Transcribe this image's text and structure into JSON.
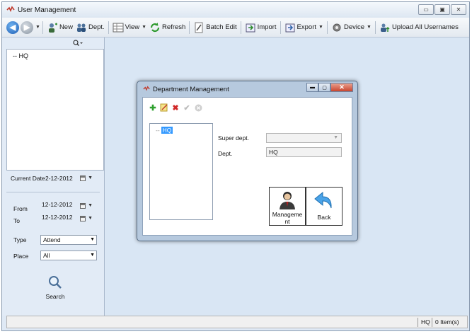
{
  "window": {
    "title": "User Management",
    "minimize": "▭",
    "maximize": "▣",
    "close": "✕"
  },
  "toolbar": {
    "new_label": "New",
    "dept_label": "Dept.",
    "view_label": "View",
    "refresh_label": "Refresh",
    "batch_edit_label": "Batch Edit",
    "import_label": "Import",
    "export_label": "Export",
    "device_label": "Device",
    "upload_label": "Upload All Usernames"
  },
  "left": {
    "tree_items": [
      "-- HQ"
    ],
    "current_date_label": "Current Date",
    "current_date": "2-12-2012",
    "from_label": "From",
    "from_value": "12-12-2012",
    "to_label": "To",
    "to_value": "12-12-2012",
    "type_label": "Type",
    "type_value": "Attend",
    "place_label": "Place",
    "place_value": "All",
    "search_label": "Search"
  },
  "status": {
    "dept": "HQ",
    "items": "0 Item(s)"
  },
  "dialog": {
    "title": "Department Management",
    "tree_prefix": "--",
    "tree_selected": "HQ",
    "super_dept_label": "Super dept.",
    "super_dept_value": "",
    "dept_label": "Dept.",
    "dept_value": "HQ",
    "management_button": "Manageme nt",
    "back_button": "Back"
  }
}
